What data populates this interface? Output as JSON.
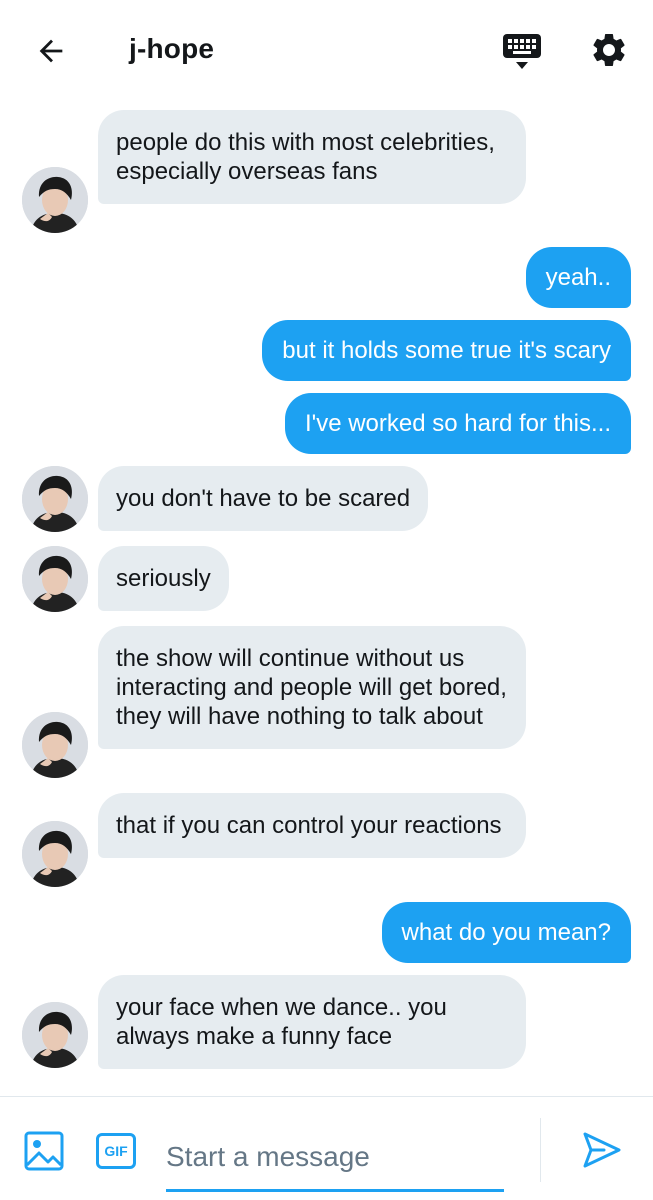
{
  "header": {
    "back_icon": "arrow-left-icon",
    "title": "j-hope",
    "keyboard_icon": "keyboard-icon",
    "settings_icon": "gear-icon"
  },
  "messages": [
    {
      "side": "in",
      "text": "people do this with most celebrities, especially overseas fans"
    },
    {
      "side": "out",
      "text": "yeah.."
    },
    {
      "side": "out",
      "text": "but it holds some true it's scary"
    },
    {
      "side": "out",
      "text": "I've worked so hard for this..."
    },
    {
      "side": "in",
      "text": "you don't have to be scared"
    },
    {
      "side": "in",
      "text": "seriously"
    },
    {
      "side": "in",
      "text": "the show will continue without us interacting and people will get bored, they will have nothing to talk about"
    },
    {
      "side": "in",
      "text": "that if you can control your reactions"
    },
    {
      "side": "out",
      "text": "what do you mean?"
    },
    {
      "side": "in",
      "text": "your face when we dance.. you always make a funny face"
    }
  ],
  "composer": {
    "image_icon": "image-icon",
    "gif_label": "GIF",
    "placeholder": "Start a message",
    "value": "",
    "send_icon": "send-icon"
  },
  "colors": {
    "accent": "#1da1f2",
    "incoming_bubble": "#e6ecf0",
    "text": "#14171a",
    "placeholder": "#657786"
  }
}
